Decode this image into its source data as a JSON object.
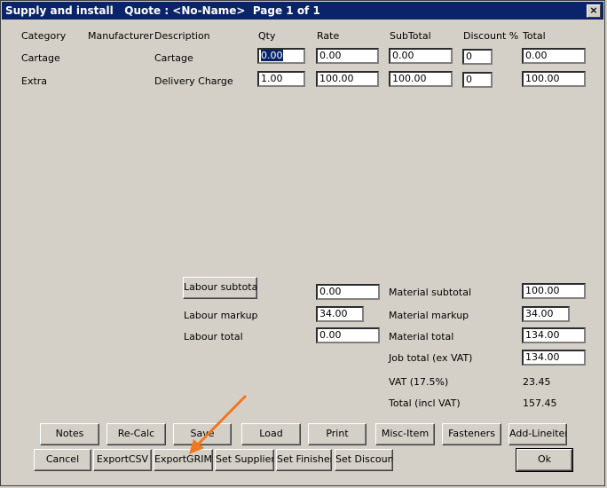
{
  "window": {
    "title": "Supply and install   Quote : <No-Name>  Page 1 of 1",
    "close": "×"
  },
  "columns": [
    "Category",
    "Manufacturer",
    "Description",
    "Qty",
    "Rate",
    "SubTotal",
    "Discount %",
    "Total"
  ],
  "rows": [
    {
      "category": "Cartage",
      "manufacturer": "",
      "description": "Cartage",
      "qty": "0.00",
      "rate": "0.00",
      "subtotal": "0.00",
      "discount": "0",
      "total": "0.00"
    },
    {
      "category": "Extra",
      "manufacturer": "",
      "description": "Delivery Charge",
      "qty": "1.00",
      "rate": "100.00",
      "subtotal": "100.00",
      "discount": "0",
      "total": "100.00"
    }
  ],
  "labour": {
    "subtotal_button": "Labour subtotal",
    "subtotal_value": "0.00",
    "markup_label": "Labour markup",
    "markup_value": "34.00",
    "total_label": "Labour total",
    "total_value": "0.00"
  },
  "material": {
    "subtotal_label": "Material subtotal",
    "subtotal_value": "100.00",
    "markup_label": "Material markup",
    "markup_value": "34.00",
    "total_label": "Material total",
    "total_value": "134.00"
  },
  "job": {
    "total_label": "Job total (ex VAT)",
    "total_value": "134.00",
    "vat_label": "VAT (17.5%)",
    "vat_value": "23.45",
    "incl_label": "Total (incl VAT)",
    "incl_value": "157.45"
  },
  "buttons_row1": [
    "Notes",
    "Re-Calc",
    "Save",
    "Load",
    "Print",
    "Misc-Item",
    "Fasteners",
    "Add-Lineitem"
  ],
  "buttons_row2": [
    "Cancel",
    "ExportCSV",
    "ExportGRIM",
    "Set Suppliers",
    "Set Finishes",
    "Set Discount"
  ],
  "ok_button": "Ok",
  "annotation": {
    "arrow_color": "#f07820"
  }
}
